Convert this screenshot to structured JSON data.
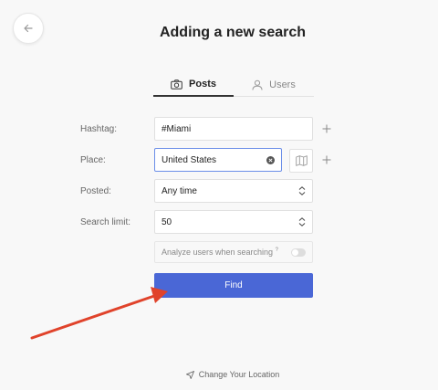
{
  "header": {
    "title": "Adding a new search"
  },
  "tabs": [
    {
      "label": "Posts",
      "icon": "camera-icon",
      "active": true
    },
    {
      "label": "Users",
      "icon": "user-icon",
      "active": false
    }
  ],
  "form": {
    "hashtag": {
      "label": "Hashtag:",
      "value": "#Miami"
    },
    "place": {
      "label": "Place:",
      "value": "United States"
    },
    "posted": {
      "label": "Posted:",
      "value": "Any time"
    },
    "limit": {
      "label": "Search limit:",
      "value": "50"
    },
    "analyze": {
      "label": "Analyze users when searching",
      "hint": "?",
      "enabled": false
    }
  },
  "actions": {
    "find_label": "Find",
    "change_location_label": "Change Your Location"
  },
  "colors": {
    "accent": "#4a67d6",
    "arrow": "#e0432b",
    "focus_border": "#6b8ee8"
  }
}
